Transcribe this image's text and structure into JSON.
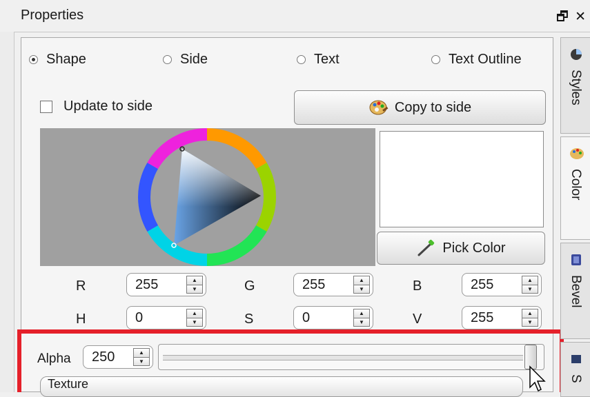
{
  "window": {
    "title": "Properties",
    "restore_glyph": "🗗",
    "close_glyph": "✕"
  },
  "radios": [
    {
      "label": "Shape",
      "checked": true
    },
    {
      "label": "Side",
      "checked": false
    },
    {
      "label": "Text",
      "checked": false
    },
    {
      "label": "Text Outline",
      "checked": false
    }
  ],
  "update_to_side": {
    "label": "Update to side",
    "checked": false
  },
  "copy_to_side": {
    "label": "Copy to side",
    "icon": "palette-icon"
  },
  "pick_color": {
    "label": "Pick Color",
    "icon": "eyedropper-icon"
  },
  "color_fields": {
    "r": {
      "label": "R",
      "value": "255"
    },
    "g": {
      "label": "G",
      "value": "255"
    },
    "b": {
      "label": "B",
      "value": "255"
    },
    "h": {
      "label": "H",
      "value": "0"
    },
    "s": {
      "label": "S",
      "value": "0"
    },
    "v": {
      "label": "V",
      "value": "255"
    }
  },
  "alpha": {
    "label": "Alpha",
    "value": "250"
  },
  "texture": {
    "label": "Texture"
  },
  "tabs": [
    {
      "label": "Styles",
      "icon": "styles-icon",
      "active": false
    },
    {
      "label": "Color",
      "icon": "palette-icon",
      "active": true
    },
    {
      "label": "Bevel",
      "icon": "bevel-icon",
      "active": false
    },
    {
      "label": "S",
      "icon": "shadow-icon",
      "active": false
    }
  ],
  "colors": {
    "highlight": "#e5202a",
    "wheel_bg": "#a0a0a0"
  }
}
